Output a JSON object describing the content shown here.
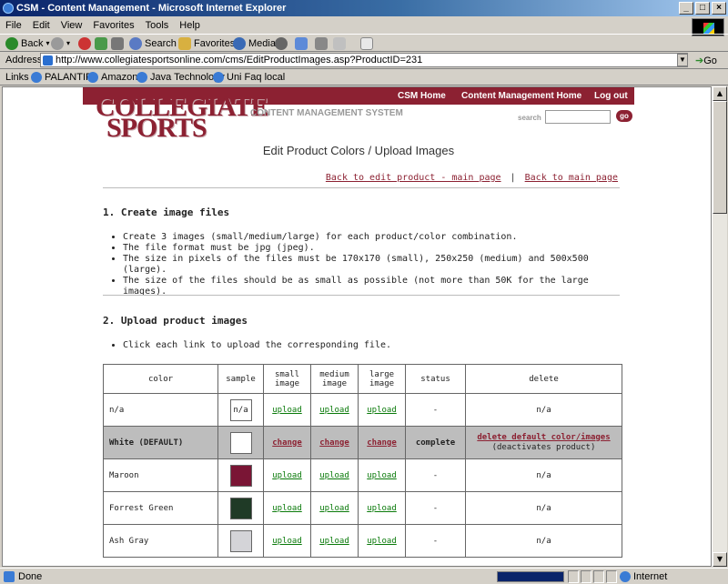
{
  "window": {
    "title": "CSM - Content Management - Microsoft Internet Explorer",
    "min": "_",
    "max": "□",
    "close": "×"
  },
  "menu": [
    "File",
    "Edit",
    "View",
    "Favorites",
    "Tools",
    "Help"
  ],
  "toolbar": {
    "back": "Back",
    "search": "Search",
    "favorites": "Favorites",
    "media": "Media"
  },
  "address": {
    "label": "Address",
    "url": "http://www.collegiatesportsonline.com/cms/EditProductImages.asp?ProductID=231",
    "go": "Go"
  },
  "links": {
    "label": "Links",
    "items": [
      "PALANTIR",
      "Amazon",
      "Java Technology",
      "Uni Faq local"
    ]
  },
  "status": {
    "text": "Done",
    "zone": "Internet",
    "progress": 1.0
  },
  "site": {
    "nav": [
      "CSM Home",
      "Content Management Home",
      "Log out"
    ],
    "logo_line1": "COLLEGIATE",
    "logo_line2": "SPORTS",
    "cms": "CONTENT MANAGEMENT SYSTEM",
    "search_label": "search",
    "go": "go",
    "page_title": "Edit Product Colors / Upload Images",
    "link_back_product": "Back to edit product - main page",
    "link_sep": "|",
    "link_back_main": "Back to main page",
    "section1": "1. Create image files",
    "bullets1": [
      "Create 3 images (small/medium/large) for each product/color combination.",
      "The file format must be jpg (jpeg).",
      "The size in pixels of the files must be 170x170 (small), 250x250 (medium) and 500x500 (large).",
      "The size of the files should be as small as possible (not more than 50K for the large images)."
    ],
    "section2": "2. Upload product images",
    "bullets2": [
      "Click each link to upload the corresponding file."
    ],
    "table": {
      "headers": [
        "color",
        "sample",
        "small image",
        "medium image",
        "large image",
        "status",
        "delete"
      ],
      "rows": [
        {
          "color": "n/a",
          "sample": "n/a",
          "swatch": "#ffffff",
          "small": "upload",
          "medium": "upload",
          "large": "upload",
          "status": "-",
          "delete": "n/a"
        },
        {
          "color": "White (DEFAULT)",
          "sample": "",
          "swatch": "#ffffff",
          "small": "change",
          "medium": "change",
          "large": "change",
          "status": "complete",
          "delete": "delete default color/images",
          "delete_note": "(deactivates product)"
        },
        {
          "color": "Maroon",
          "sample": "",
          "swatch": "#7a1535",
          "small": "upload",
          "medium": "upload",
          "large": "upload",
          "status": "-",
          "delete": "n/a"
        },
        {
          "color": "Forrest Green",
          "sample": "",
          "swatch": "#1f3a26",
          "small": "upload",
          "medium": "upload",
          "large": "upload",
          "status": "-",
          "delete": "n/a"
        },
        {
          "color": "Ash Gray",
          "sample": "",
          "swatch": "#d4d4d8",
          "small": "upload",
          "medium": "upload",
          "large": "upload",
          "status": "-",
          "delete": "n/a"
        }
      ]
    }
  },
  "colors": {
    "brand": "#8c2132",
    "titlebar": "#0a246a",
    "link_green": "#0a7a0a"
  }
}
